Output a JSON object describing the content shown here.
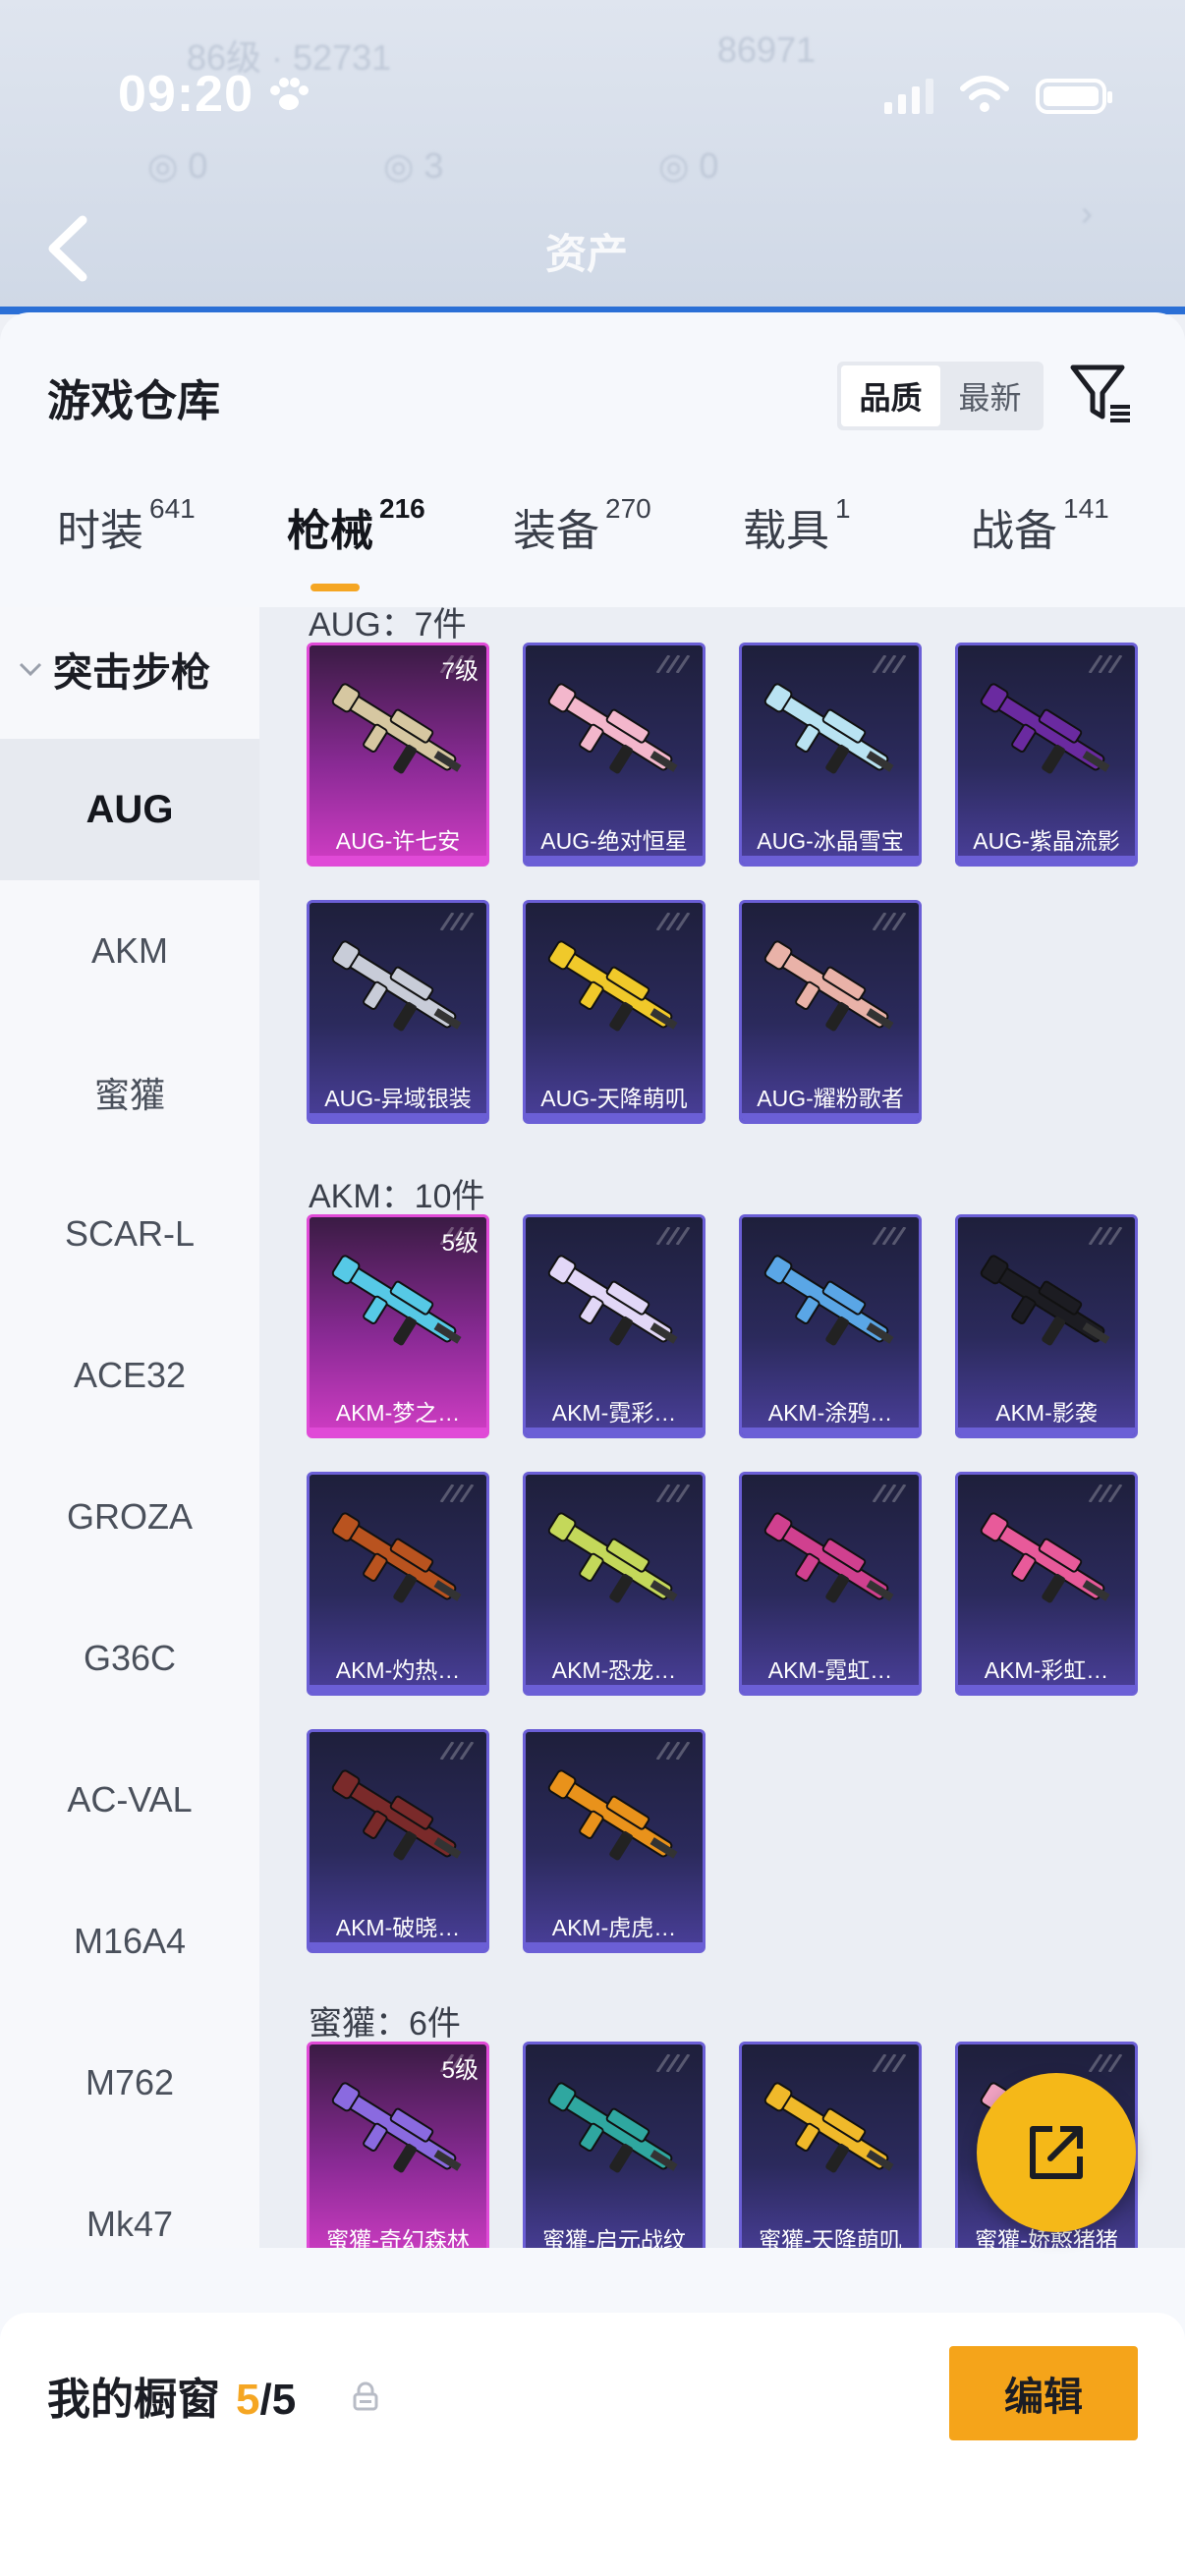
{
  "status": {
    "time": "09:20"
  },
  "header": {
    "title": "资产"
  },
  "sheet": {
    "title": "游戏仓库",
    "sort_options": [
      "品质",
      "最新"
    ],
    "active_sort": "品质"
  },
  "tabs": [
    {
      "label": "时装",
      "count": "641"
    },
    {
      "label": "枪械",
      "count": "216"
    },
    {
      "label": "装备",
      "count": "270"
    },
    {
      "label": "载具",
      "count": "1"
    },
    {
      "label": "战备",
      "count": "141"
    }
  ],
  "sidebar": {
    "group": "突击步枪",
    "items": [
      "AUG",
      "AKM",
      "蜜獾",
      "SCAR-L",
      "ACE32",
      "GROZA",
      "G36C",
      "AC-VAL",
      "M16A4",
      "M762",
      "Mk47"
    ],
    "active": "AUG"
  },
  "sections": [
    {
      "title": "AUG：7件",
      "cards": [
        {
          "name": "AUG-许七安",
          "level": "7级",
          "rarity": "pink",
          "color": "#d6c7a1"
        },
        {
          "name": "AUG-绝对恒星",
          "level": "",
          "rarity": "purple",
          "color": "#f3b7cc"
        },
        {
          "name": "AUG-冰晶雪宝",
          "level": "",
          "rarity": "purple",
          "color": "#b9e3f2"
        },
        {
          "name": "AUG-紫晶流影",
          "level": "",
          "rarity": "purple",
          "color": "#6a2aa0"
        },
        {
          "name": "AUG-异域银装",
          "level": "",
          "rarity": "purple",
          "color": "#c8ccd8"
        },
        {
          "name": "AUG-天降萌叽",
          "level": "",
          "rarity": "purple",
          "color": "#f0c92a"
        },
        {
          "name": "AUG-耀粉歌者",
          "level": "",
          "rarity": "purple",
          "color": "#e9b2a8"
        }
      ]
    },
    {
      "title": "AKM：10件",
      "cards": [
        {
          "name": "AKM-梦之…",
          "level": "5级",
          "rarity": "pink",
          "color": "#56c9e6"
        },
        {
          "name": "AKM-霓彩…",
          "level": "",
          "rarity": "purple",
          "color": "#e2d7f7"
        },
        {
          "name": "AKM-涂鸦…",
          "level": "",
          "rarity": "purple",
          "color": "#5aa6e6"
        },
        {
          "name": "AKM-影袭",
          "level": "",
          "rarity": "purple",
          "color": "#1c1c22"
        },
        {
          "name": "AKM-灼热…",
          "level": "",
          "rarity": "purple",
          "color": "#b9531f"
        },
        {
          "name": "AKM-恐龙…",
          "level": "",
          "rarity": "purple",
          "color": "#c4d85a"
        },
        {
          "name": "AKM-霓虹…",
          "level": "",
          "rarity": "purple",
          "color": "#d0408f"
        },
        {
          "name": "AKM-彩虹…",
          "level": "",
          "rarity": "purple",
          "color": "#e85a9a"
        },
        {
          "name": "AKM-破晓…",
          "level": "",
          "rarity": "purple",
          "color": "#7a2a2a"
        },
        {
          "name": "AKM-虎虎…",
          "level": "",
          "rarity": "purple",
          "color": "#e9921b"
        }
      ]
    },
    {
      "title": "蜜獾：6件",
      "cards": [
        {
          "name": "蜜獾-奇幻森林",
          "level": "5级",
          "rarity": "pink",
          "color": "#8a6ae0"
        },
        {
          "name": "蜜獾-启元战纹",
          "level": "",
          "rarity": "purple",
          "color": "#2fa7a0"
        },
        {
          "name": "蜜獾-天降萌叽",
          "level": "",
          "rarity": "purple",
          "color": "#f0b92a"
        },
        {
          "name": "蜜獾-娇憨猪猪",
          "level": "",
          "rarity": "purple",
          "color": "#f0a2c2"
        }
      ]
    }
  ],
  "showcase": {
    "title": "我的橱窗",
    "current": "5",
    "separator": "/",
    "total": "5",
    "edit_label": "编辑"
  }
}
